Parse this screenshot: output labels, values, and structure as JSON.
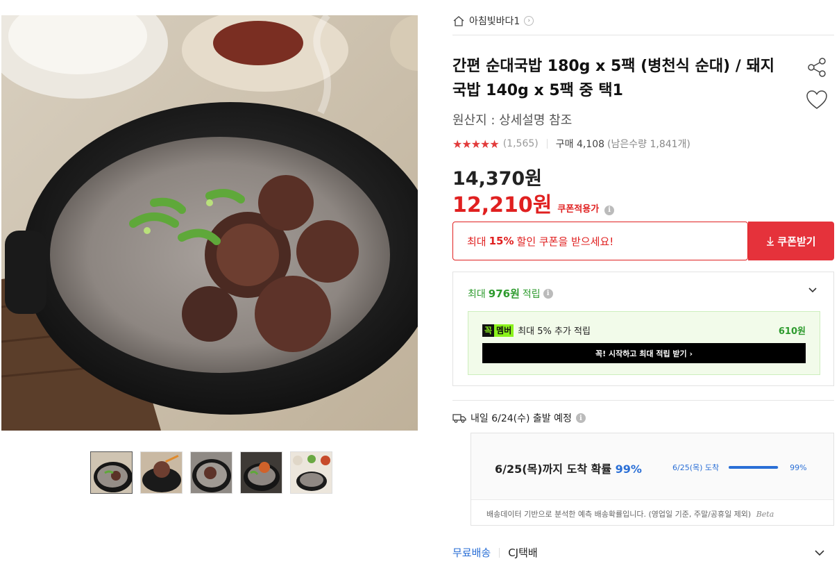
{
  "shop": {
    "name": "아침빛바다1",
    "home_icon": "home-icon",
    "chevron_icon": "chevron-right-icon"
  },
  "product": {
    "title": "간편 순대국밥 180g x 5팩 (병천식 순대) / 돼지국밥 140g x 5팩 중 택1",
    "origin": "원산지 : 상세설명 참조",
    "rating": {
      "stars": "★★★★★",
      "score": 4.5,
      "review_count": "(1,565)"
    },
    "purchase_label": "구매 4,108",
    "remaining": "(남은수량 1,841개)"
  },
  "price": {
    "original": "14,370원",
    "sale": "12,210원",
    "coupon_applied_label": "쿠폰적용가"
  },
  "coupon": {
    "prefix": "최대",
    "percent": "15%",
    "suffix": "할인 쿠폰을 받으세요!",
    "button_label": "쿠폰받기"
  },
  "points": {
    "prefix": "최대",
    "amount": "976원",
    "suffix": "적립",
    "member": {
      "logo_a": "꼭",
      "logo_b": "멤버",
      "text": "최대 5% 추가 적립",
      "amount": "610원",
      "button_label": "꼭! 시작하고 최대 적립 받기 ›"
    }
  },
  "shipping": {
    "departure": "내일 6/24(수) 출발 예정",
    "arrival_prefix": "6/25(목)까지 도착 확률",
    "arrival_pct": "99%",
    "bar_label": "6/25(목) 도착",
    "bar_value_label": "99%",
    "bar_value": 0.99,
    "note": "배송데이터 기반으로 분석한 예측 배송확률입니다. (영업일 기준, 주말/공휴일 제외)",
    "beta": "Beta"
  },
  "delivery": {
    "free": "무료배송",
    "courier": "CJ택배"
  },
  "colors": {
    "sale_red": "#e02020",
    "coupon_btn": "#e5323b",
    "points_green": "#2e9b2e",
    "blue": "#2a6fd6",
    "member_lime": "#8bf21c"
  }
}
